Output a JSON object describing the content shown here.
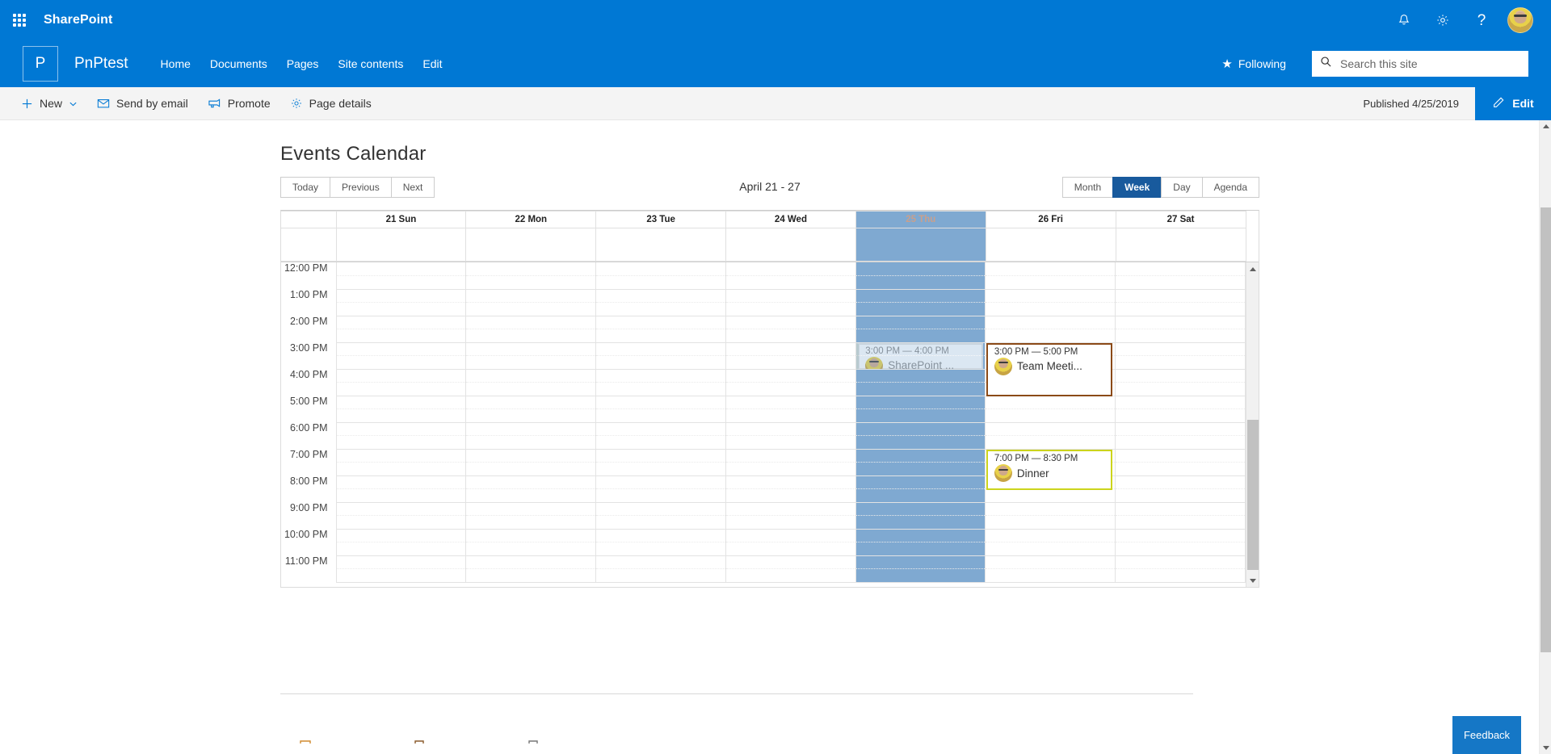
{
  "suite": {
    "waffle_icon": "app-launcher-waffle-icon",
    "title": "SharePoint",
    "notifications_icon": "bell-icon",
    "settings_icon": "gear-icon",
    "help_icon": "question-mark-icon",
    "avatar_icon": "user-avatar"
  },
  "site": {
    "logo_letter": "P",
    "name": "PnPtest",
    "nav": [
      {
        "label": "Home"
      },
      {
        "label": "Documents"
      },
      {
        "label": "Pages"
      },
      {
        "label": "Site contents"
      },
      {
        "label": "Edit"
      }
    ],
    "following_label": "Following",
    "following_icon": "star-icon"
  },
  "search": {
    "placeholder": "Search this site",
    "value": "",
    "icon": "search-icon"
  },
  "commandbar": {
    "items": [
      {
        "label": "New",
        "icon": "plus-icon",
        "chevron": "chevron-down-icon"
      },
      {
        "label": "Send by email",
        "icon": "mail-icon"
      },
      {
        "label": "Promote",
        "icon": "promote-megaphone-icon"
      },
      {
        "label": "Page details",
        "icon": "gear-icon"
      }
    ],
    "published_status": "Published 4/25/2019",
    "edit_label": "Edit",
    "edit_icon": "pencil-icon"
  },
  "page": {
    "title": "Events Calendar"
  },
  "calendar": {
    "nav_buttons": [
      {
        "label": "Today",
        "active": false
      },
      {
        "label": "Previous",
        "active": false
      },
      {
        "label": "Next",
        "active": false
      }
    ],
    "range_label": "April 21 - 27",
    "view_buttons": [
      {
        "label": "Month",
        "active": false
      },
      {
        "label": "Week",
        "active": true
      },
      {
        "label": "Day",
        "active": false
      },
      {
        "label": "Agenda",
        "active": false
      }
    ],
    "day_headers": [
      {
        "label": "21 Sun",
        "today": false
      },
      {
        "label": "22 Mon",
        "today": false
      },
      {
        "label": "23 Tue",
        "today": false
      },
      {
        "label": "24 Wed",
        "today": false
      },
      {
        "label": "25 Thu",
        "today": true
      },
      {
        "label": "26 Fri",
        "today": false
      },
      {
        "label": "27 Sat",
        "today": false
      }
    ],
    "time_labels": [
      "12:00 PM",
      "1:00 PM",
      "2:00 PM",
      "3:00 PM",
      "4:00 PM",
      "5:00 PM",
      "6:00 PM",
      "7:00 PM",
      "8:00 PM",
      "9:00 PM",
      "10:00 PM",
      "11:00 PM"
    ],
    "today_column_index": 4,
    "today_highlight_color": "#7fa9d1",
    "events": [
      {
        "time": "3:00 PM — 4:00 PM",
        "title": "SharePoint ...",
        "day": "25 Thu",
        "border_color": "#e4e4e4",
        "style": "faded"
      },
      {
        "time": "3:00 PM — 5:00 PM",
        "title": "Team Meeti...",
        "day": "26 Fri",
        "border_color": "#8b4a17",
        "style": "normal"
      },
      {
        "time": "7:00 PM — 8:30 PM",
        "title": "Dinner",
        "day": "26 Fri",
        "border_color": "#ccd41c",
        "style": "normal"
      }
    ],
    "scrollbar": {
      "up_icon": "scroll-up-arrow-icon",
      "down_icon": "scroll-down-arrow-icon"
    }
  },
  "feedback": {
    "label": "Feedback"
  },
  "page_scrollbar": {
    "up_icon": "scroll-up-arrow-icon",
    "down_icon": "scroll-down-arrow-icon"
  },
  "theme": {
    "brand_blue": "#0078d4",
    "active_view_blue": "#185a9d",
    "command_bar_bg": "#f4f4f4"
  }
}
